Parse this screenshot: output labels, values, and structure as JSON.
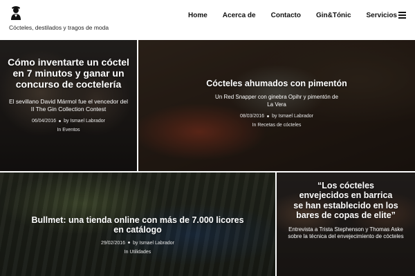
{
  "site": {
    "logo_icon": "bartender-logo-icon",
    "tagline": "Cócteles, destilados y tragos de moda"
  },
  "nav": {
    "items": [
      {
        "label": "Home"
      },
      {
        "label": "Acerca de"
      },
      {
        "label": "Contacto"
      },
      {
        "label": "Gin&Tónic"
      },
      {
        "label": "Servicios"
      }
    ],
    "menu_icon": "hamburger-menu-icon"
  },
  "posts": [
    {
      "title": "Cómo inventarte un cóctel en 7 minutos y ganar un concurso de coctelería",
      "excerpt": "El sevillano David Mármol fue el vencedor del II The Gin Collection Contest",
      "date": "06/04/2016",
      "author": "by Ismael Labrador",
      "category": "In Eventos"
    },
    {
      "title": "Cócteles ahumados con pimentón",
      "excerpt": "Un Red Snapper con ginebra Opihr y pimentón de La Vera",
      "date": "08/03/2016",
      "author": "by Ismael Labrador",
      "category": "In Recetas de cócteles"
    },
    {
      "title": "Bullmet: una tienda online con más de 7.000 licores en catálogo",
      "date": "29/02/2016",
      "author": "by Ismael Labrador",
      "category": "In Utilidades"
    },
    {
      "title": "“Los cócteles envejecidos en barrica se han establecido en los bares de copas de elite”",
      "excerpt": "Entrevista a Trista Stephenson y Thomas Aske sobre la técnica del envejecimiento de cócteles"
    }
  ]
}
